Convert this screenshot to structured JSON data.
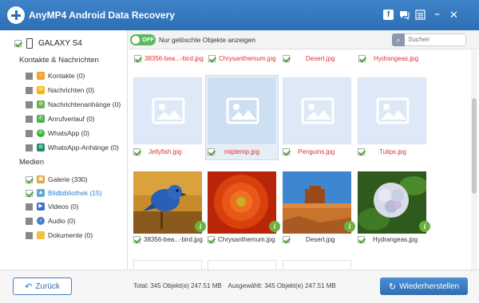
{
  "app": {
    "title": "AnyMP4 Android Data Recovery",
    "titlebar_icons": [
      "facebook-icon",
      "chat-icon",
      "menu-icon",
      "minimize-icon",
      "close-icon"
    ]
  },
  "sidebar": {
    "device": {
      "name": "GALAXY S4",
      "checked": true
    },
    "sections": [
      {
        "title": "Kontakte & Nachrichten",
        "items": [
          {
            "label": "Kontakte (0)",
            "icon": "contacts-icon",
            "color": "#f0a030",
            "checked": false
          },
          {
            "label": "Nachrichten (0)",
            "icon": "messages-icon",
            "color": "#f5b800",
            "checked": false
          },
          {
            "label": "Nachrichtenanhänge (0)",
            "icon": "attachment-icon",
            "color": "#6ab04c",
            "checked": false
          },
          {
            "label": "Anrufverlauf (0)",
            "icon": "phone-icon",
            "color": "#4caf50",
            "checked": false
          },
          {
            "label": "WhatsApp (0)",
            "icon": "whatsapp-icon",
            "color": "#2eb82e",
            "checked": false
          },
          {
            "label": "WhatsApp-Anhänge (0)",
            "icon": "whatsapp-attachment-icon",
            "color": "#1f8f6a",
            "checked": false
          }
        ]
      },
      {
        "title": "Medien",
        "items": [
          {
            "label": "Galerie (330)",
            "icon": "gallery-icon",
            "color": "#e8a23a",
            "checked": true,
            "active": false
          },
          {
            "label": "Bildbibliothek (15)",
            "icon": "picture-library-icon",
            "color": "#5fa8d3",
            "checked": true,
            "active": true
          },
          {
            "label": "Videos (0)",
            "icon": "video-icon",
            "color": "#3f6fc4",
            "checked": false
          },
          {
            "label": "Audio (0)",
            "icon": "audio-icon",
            "color": "#4a7fc7",
            "checked": false
          },
          {
            "label": "Dokumente (0)",
            "icon": "folder-icon",
            "color": "#f0c040",
            "checked": false
          }
        ]
      }
    ]
  },
  "toolbar": {
    "toggle_state": "OFF",
    "toggle_label": "Nur gelöschte Objekte anzeigen",
    "search_placeholder": "Suchen"
  },
  "grid": {
    "row_top_captions": [
      {
        "name": "38356-bea...-bird.jpg",
        "deleted": true
      },
      {
        "name": "Chrysanthemum.jpg",
        "deleted": true
      },
      {
        "name": "Desert.jpg",
        "deleted": true
      },
      {
        "name": "Hydrangeas.jpg",
        "deleted": true
      }
    ],
    "placeholder_row": [
      {
        "name": "Jellyfish.jpg",
        "deleted": true,
        "selected": false
      },
      {
        "name": "mtptemp.jpg",
        "deleted": true,
        "selected": true
      },
      {
        "name": "Penguins.jpg",
        "deleted": true,
        "selected": false
      },
      {
        "name": "Tulips.jpg",
        "deleted": true,
        "selected": false
      }
    ],
    "photo_row": [
      {
        "name": "38356-bea...-bird.jpg",
        "deleted": false,
        "image": "blue-bird"
      },
      {
        "name": "Chrysanthemum.jpg",
        "deleted": false,
        "image": "chrysanthemum"
      },
      {
        "name": "Desert.jpg",
        "deleted": false,
        "image": "desert"
      },
      {
        "name": "Hydrangeas.jpg",
        "deleted": false,
        "image": "hydrangeas"
      }
    ],
    "colors": {
      "deleted_text": "#e03030",
      "normal_text": "#333333",
      "placeholder_bg": "#dde9f7",
      "info_badge": "#6bb13c"
    }
  },
  "footer": {
    "back_label": "Zurück",
    "total": "Total: 345 Objekt(e) 247.51 MB",
    "selected": "Ausgewählt: 345 Objekt(e) 247.51 MB",
    "recover_label": "Wiederherstellen"
  }
}
